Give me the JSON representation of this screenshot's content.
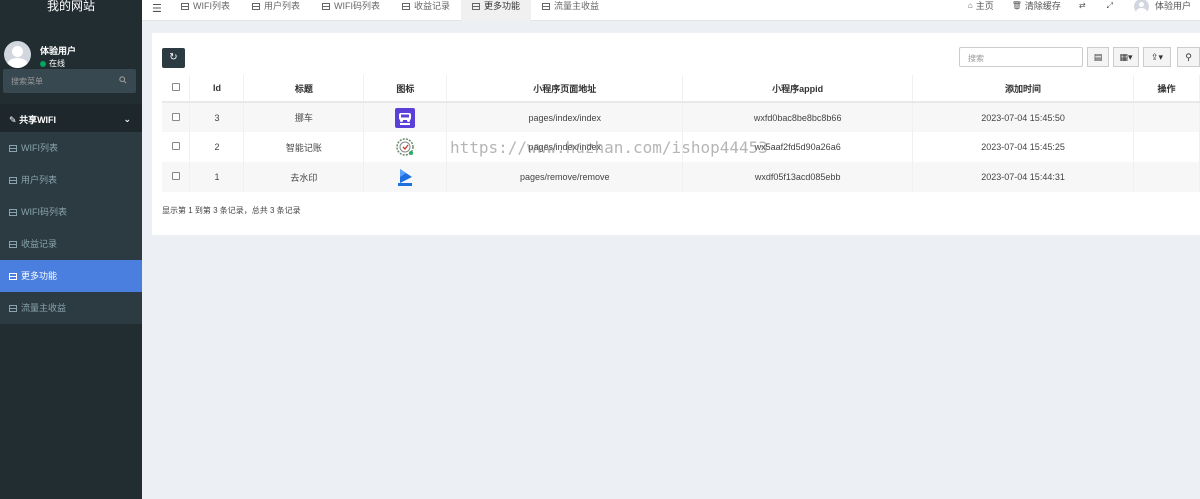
{
  "sidebar": {
    "site_title": "我的网站",
    "user_name": "体验用户",
    "user_status": "在线",
    "search_placeholder": "搜索菜单",
    "group_label": "共享WIFI",
    "items": [
      {
        "label": "WIFI列表"
      },
      {
        "label": "用户列表"
      },
      {
        "label": "WIFI码列表"
      },
      {
        "label": "收益记录"
      },
      {
        "label": "更多功能",
        "active": true
      },
      {
        "label": "流量主收益"
      }
    ]
  },
  "topnav": {
    "tabs": [
      {
        "label": "WIFI列表"
      },
      {
        "label": "用户列表"
      },
      {
        "label": "WIFI码列表"
      },
      {
        "label": "收益记录"
      },
      {
        "label": "更多功能",
        "active": true
      },
      {
        "label": "流量主收益"
      }
    ],
    "home_label": "主页",
    "clear_cache_label": "清除缓存",
    "user_label": "体验用户"
  },
  "toolbar": {
    "search_placeholder": "搜索"
  },
  "table": {
    "columns": [
      "Id",
      "标题",
      "图标",
      "小程序页面地址",
      "小程序appid",
      "添加时间",
      "操作"
    ],
    "rows": [
      {
        "id": "3",
        "title": "挪车",
        "icon": "car-app-icon",
        "page": "pages/index/index",
        "appid": "wxfd0bac8be8bc8b66",
        "time": "2023-07-04 15:45:50"
      },
      {
        "id": "2",
        "title": "智能记账",
        "icon": "ledger-app-icon",
        "page": "pages/index/index",
        "appid": "wx5aaf2fd5d90a26a6",
        "time": "2023-07-04 15:45:25"
      },
      {
        "id": "1",
        "title": "去水印",
        "icon": "play-app-icon",
        "page": "pages/remove/remove",
        "appid": "wxdf05f13acd085ebb",
        "time": "2023-07-04 15:44:31"
      }
    ],
    "summary": "显示第 1 到第 3 条记录，总共 3 条记录"
  },
  "watermark": "https://www.huzhan.com/ishop44453",
  "colors": {
    "sidebar_bg": "#222d32",
    "active_item": "#4a7fe0",
    "status_green": "#00a65a"
  }
}
